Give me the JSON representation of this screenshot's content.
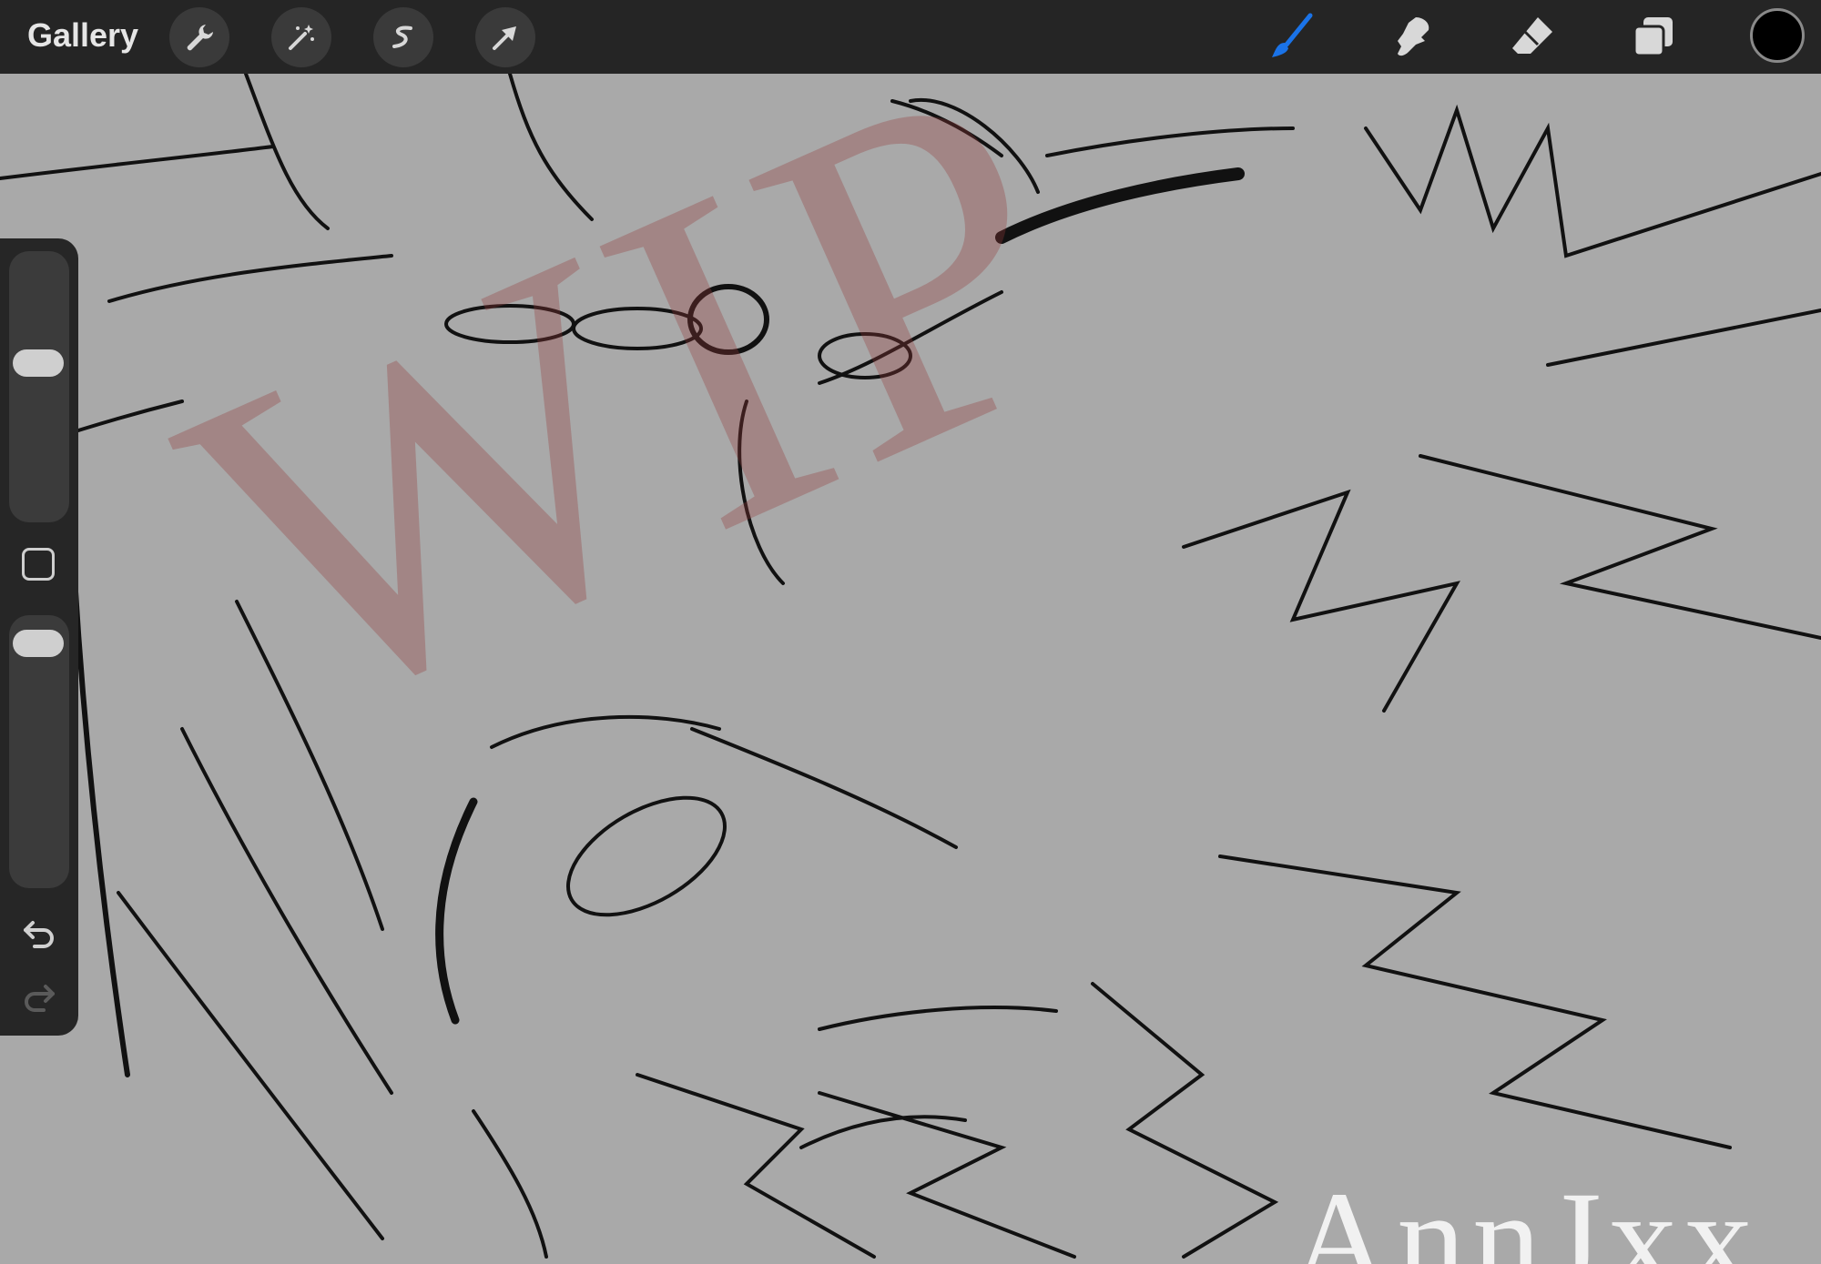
{
  "topbar": {
    "gallery_label": "Gallery",
    "left_tools": [
      "wrench-icon",
      "magic-wand-icon",
      "selection-icon",
      "transform-arrow-icon"
    ],
    "right_tools": [
      "brush-icon",
      "smudge-icon",
      "eraser-icon",
      "layers-icon"
    ],
    "active_tool": "brush-icon",
    "accent_color": "#1a73e8",
    "current_color": "#000000"
  },
  "sidebar": {
    "controls": [
      "brush-size-slider",
      "modify-button",
      "opacity-slider",
      "undo-icon",
      "redo-icon"
    ]
  },
  "canvas": {
    "background": "#a9a9a9",
    "watermark_text": "WIP",
    "signature_text": "AnnJxx"
  }
}
